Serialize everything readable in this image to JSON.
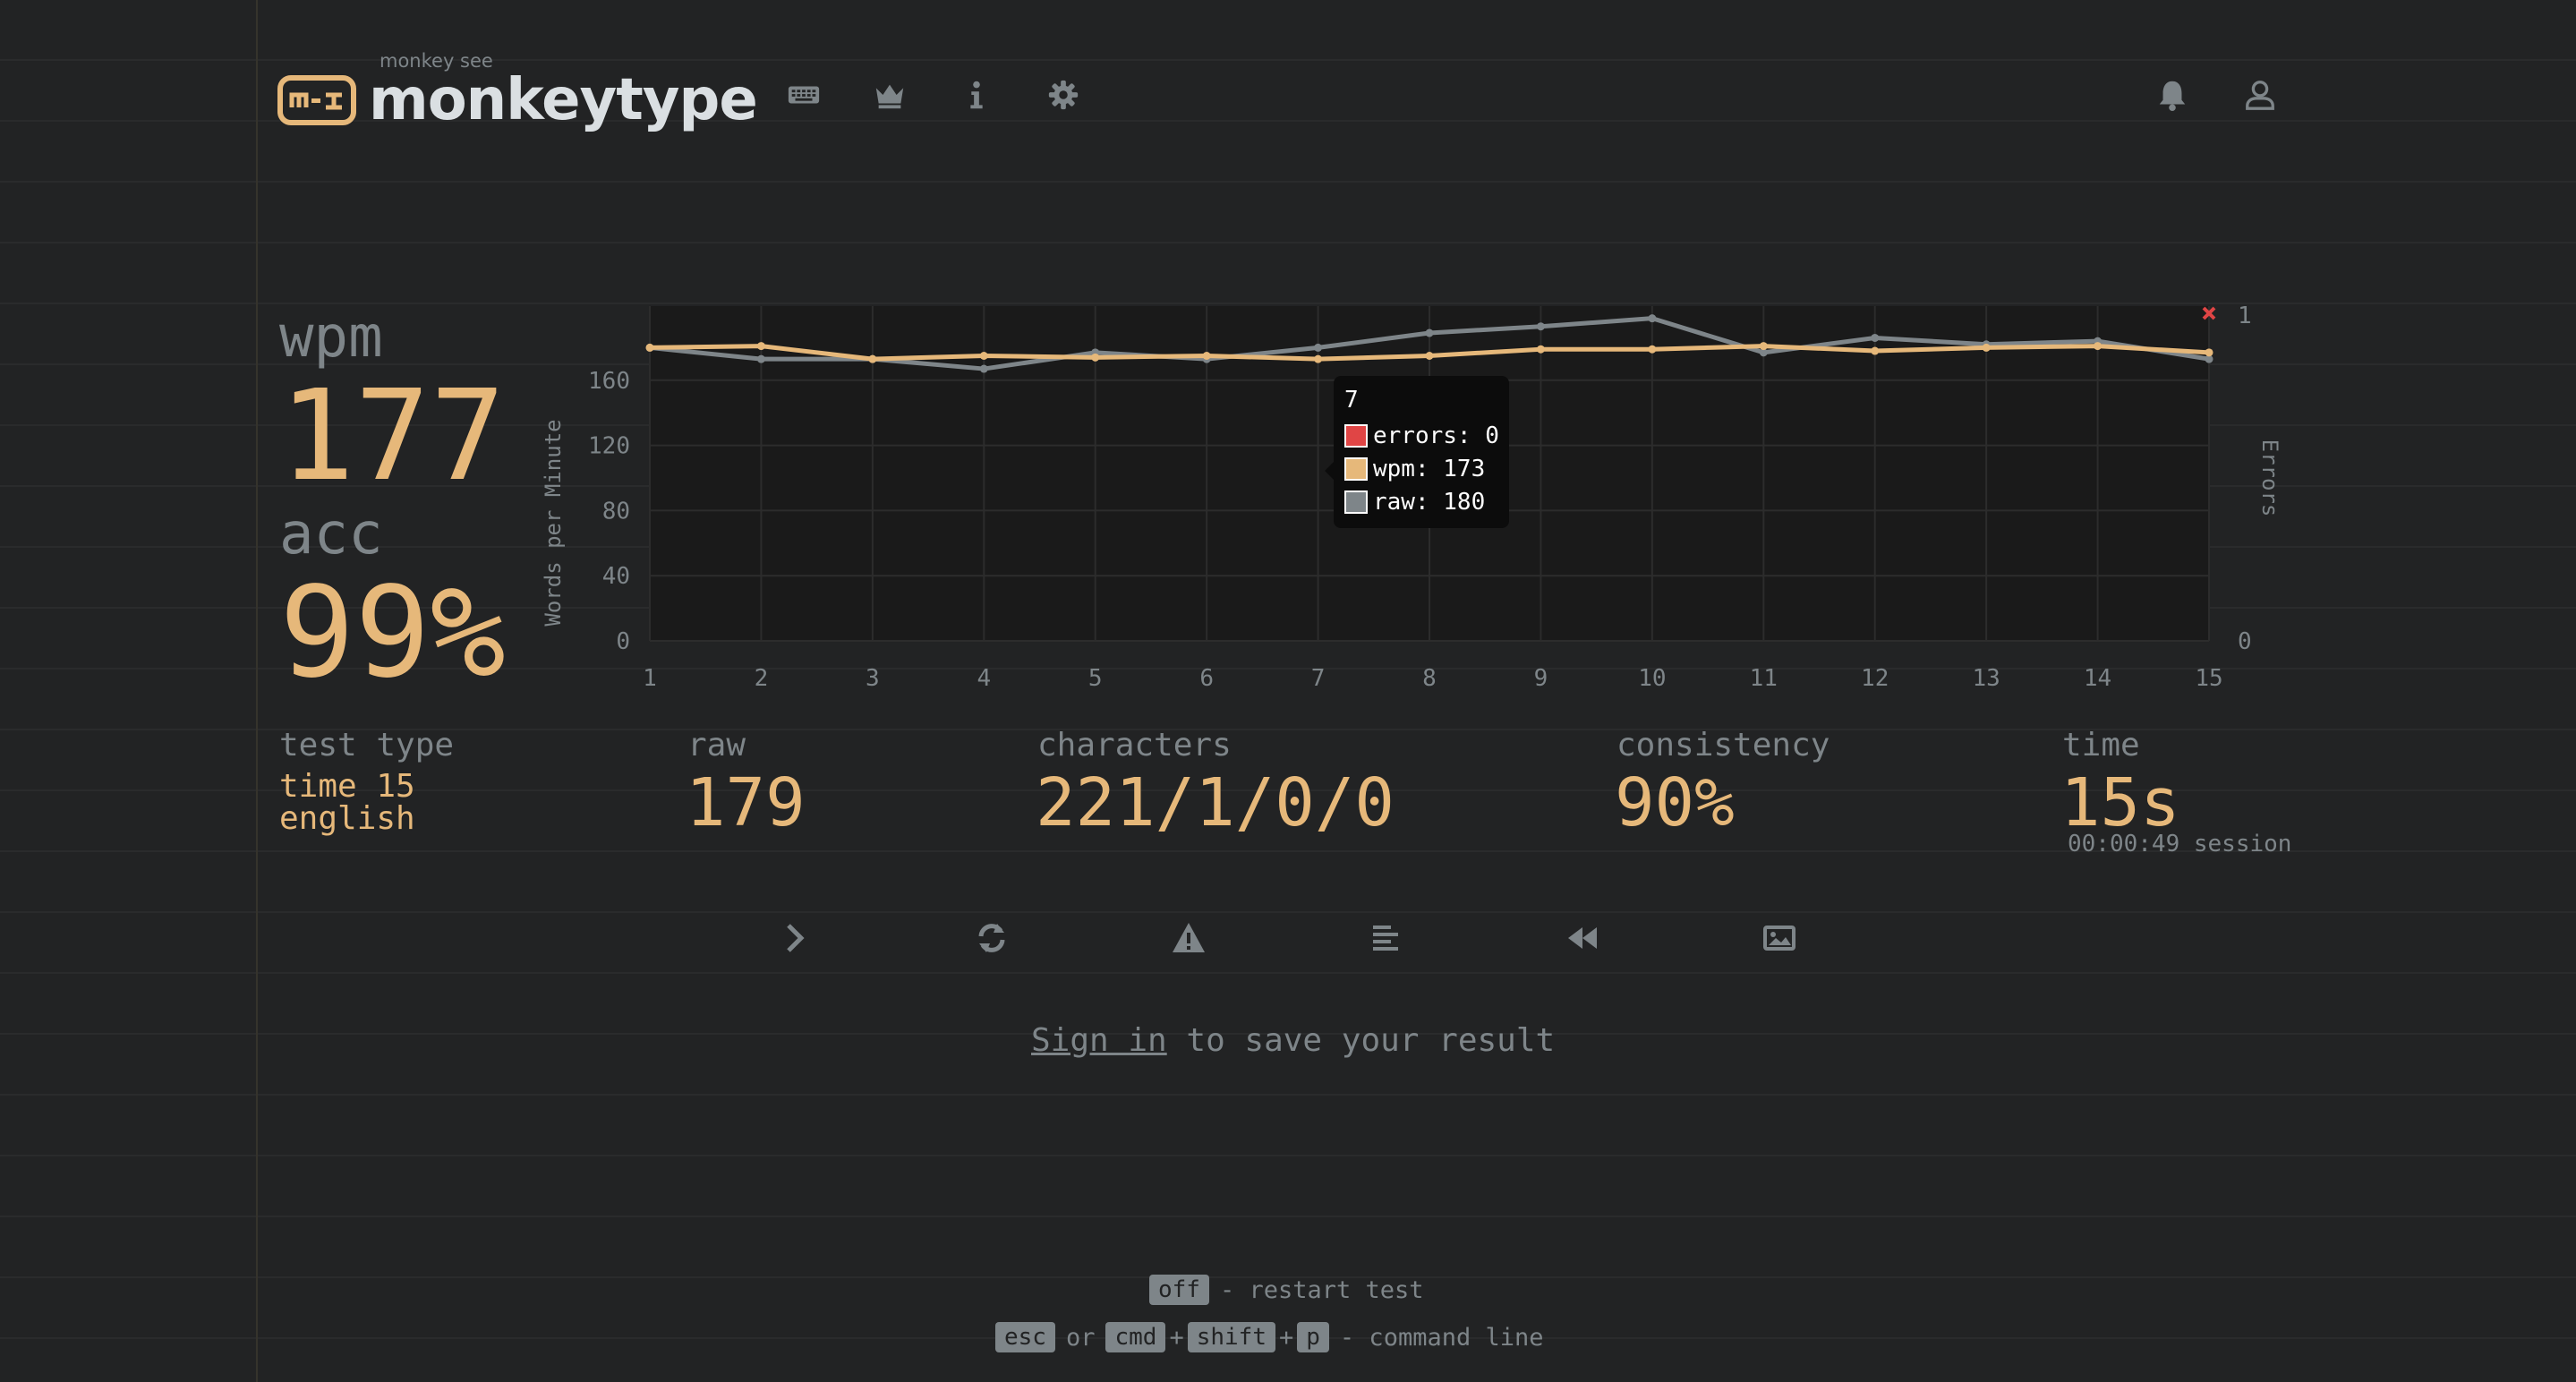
{
  "header": {
    "logo_sub": "monkey see",
    "logo_main": "monkeytype",
    "nav": [
      "keyboard-icon",
      "crown-icon",
      "info-icon",
      "gear-icon"
    ],
    "right": [
      "bell-icon",
      "user-icon"
    ]
  },
  "results": {
    "wpm_label": "wpm",
    "wpm_value": "177",
    "acc_label": "acc",
    "acc_value": "99%"
  },
  "chart_data": {
    "type": "line",
    "x": [
      1,
      2,
      3,
      4,
      5,
      6,
      7,
      8,
      9,
      10,
      11,
      12,
      13,
      14,
      15
    ],
    "series": [
      {
        "name": "wpm",
        "values": [
          180,
          181,
          173,
          175,
          174,
          175,
          173,
          175,
          179,
          179,
          181,
          178,
          180,
          181,
          177
        ]
      },
      {
        "name": "raw",
        "values": [
          180,
          173,
          173,
          167,
          177,
          173,
          180,
          189,
          193,
          198,
          177,
          186,
          182,
          184,
          173
        ]
      }
    ],
    "errors": {
      "x": 15,
      "value": 1
    },
    "ylabel": "Words per Minute",
    "y2label": "Errors",
    "y_ticks": [
      "0",
      "40",
      "80",
      "120",
      "160"
    ],
    "y2_ticks": [
      "0",
      "1"
    ],
    "x_ticks": [
      "1",
      "2",
      "3",
      "4",
      "5",
      "6",
      "7",
      "8",
      "9",
      "10",
      "11",
      "12",
      "13",
      "14",
      "15"
    ],
    "ylim": [
      0,
      200
    ],
    "colors": {
      "wpm": "#e6b87a",
      "raw": "#7e8589",
      "errors": "#e04545",
      "grid": "#2c2c2c",
      "plot_bg": "#1a1a1a"
    }
  },
  "tooltip": {
    "title": "7",
    "errors": "errors: 0",
    "wpm": "wpm: 173",
    "raw": "raw: 180",
    "colors": {
      "errors": "#e04545",
      "wpm": "#e6b87a",
      "raw": "#7e8589"
    }
  },
  "stats": {
    "test_type_label": "test type",
    "test_type_line1": "time 15",
    "test_type_line2": "english",
    "raw_label": "raw",
    "raw_value": "179",
    "characters_label": "characters",
    "characters_value": "221/1/0/0",
    "consistency_label": "consistency",
    "consistency_value": "90%",
    "time_label": "time",
    "time_value": "15s",
    "session": "00:00:49 session"
  },
  "actions": [
    "next-test-icon",
    "restart-icon",
    "report-icon",
    "words-history-icon",
    "replay-icon",
    "screenshot-icon"
  ],
  "signin": {
    "link": "Sign in",
    "rest": " to save your result"
  },
  "footer": {
    "line1_key": "off",
    "line1_text": "- restart test",
    "line2_keys": [
      "esc",
      "cmd",
      "shift",
      "p"
    ],
    "or": "or",
    "plus": "+",
    "line2_text": "- command line"
  }
}
